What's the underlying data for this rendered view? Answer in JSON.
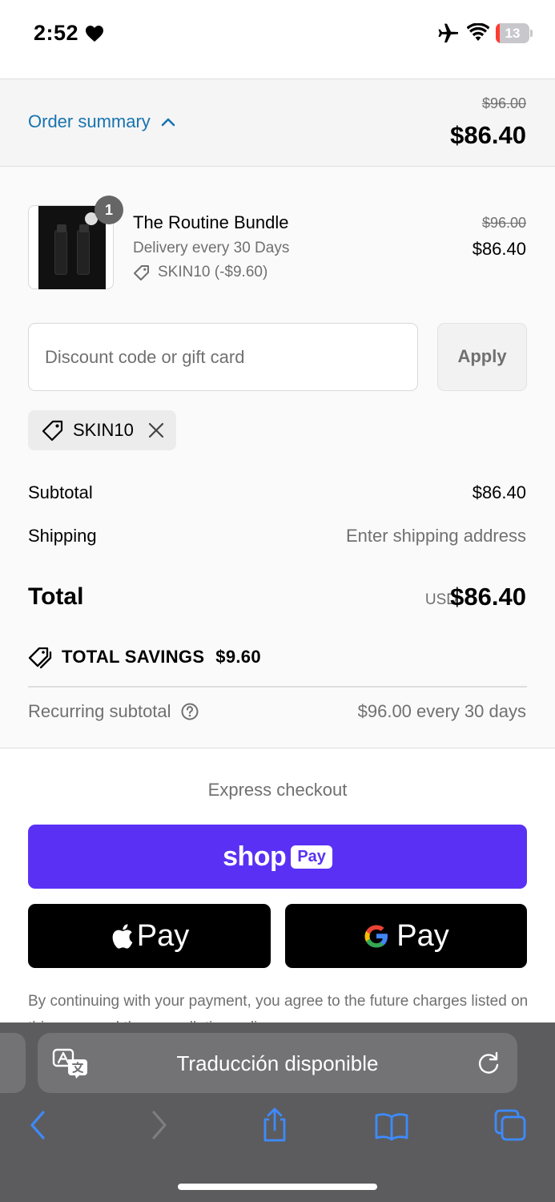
{
  "status_bar": {
    "time": "2:52",
    "battery_level": "13",
    "battery_fraction": 0.13
  },
  "summary": {
    "toggle_label": "Order summary",
    "original_total": "$96.00",
    "total": "$86.40"
  },
  "product": {
    "quantity": "1",
    "title": "The Routine Bundle",
    "delivery": "Delivery every 30 Days",
    "discount_line": "SKIN10 (-$9.60)",
    "original_price": "$96.00",
    "price": "$86.40"
  },
  "discount": {
    "placeholder": "Discount code or gift card",
    "apply_label": "Apply",
    "applied_code": "SKIN10"
  },
  "totals": {
    "subtotal_label": "Subtotal",
    "subtotal_value": "$86.40",
    "shipping_label": "Shipping",
    "shipping_value": "Enter shipping address",
    "total_label": "Total",
    "currency": "USD",
    "total_value": "$86.40",
    "savings_label": "TOTAL SAVINGS",
    "savings_value": "$9.60",
    "recurring_label": "Recurring subtotal",
    "recurring_value": "$96.00 every 30 days"
  },
  "express": {
    "title": "Express checkout",
    "shop_word": "shop",
    "shop_pay_box": "Pay",
    "apple_pay_word": "Pay",
    "google_pay_word": "Pay"
  },
  "legal_text": "By continuing with your payment, you agree to the future charges listed on this page and the cancellation policy.",
  "safari": {
    "translate_text": "Traducción disponible"
  },
  "colors": {
    "accent_link": "#1773b0",
    "shop_pay": "#5a31f4",
    "battery_low": "#ff3b30",
    "safari_blue": "#3d8bff"
  },
  "icons": [
    "heart-icon",
    "airplane-icon",
    "wifi-icon",
    "chevron-up-icon",
    "tag-icon",
    "close-icon",
    "savings-tag-icon",
    "help-icon",
    "apple-icon",
    "google-g-icon",
    "translate-icon",
    "reload-icon",
    "back-icon",
    "forward-icon",
    "share-icon",
    "bookmarks-icon",
    "tabs-icon"
  ]
}
